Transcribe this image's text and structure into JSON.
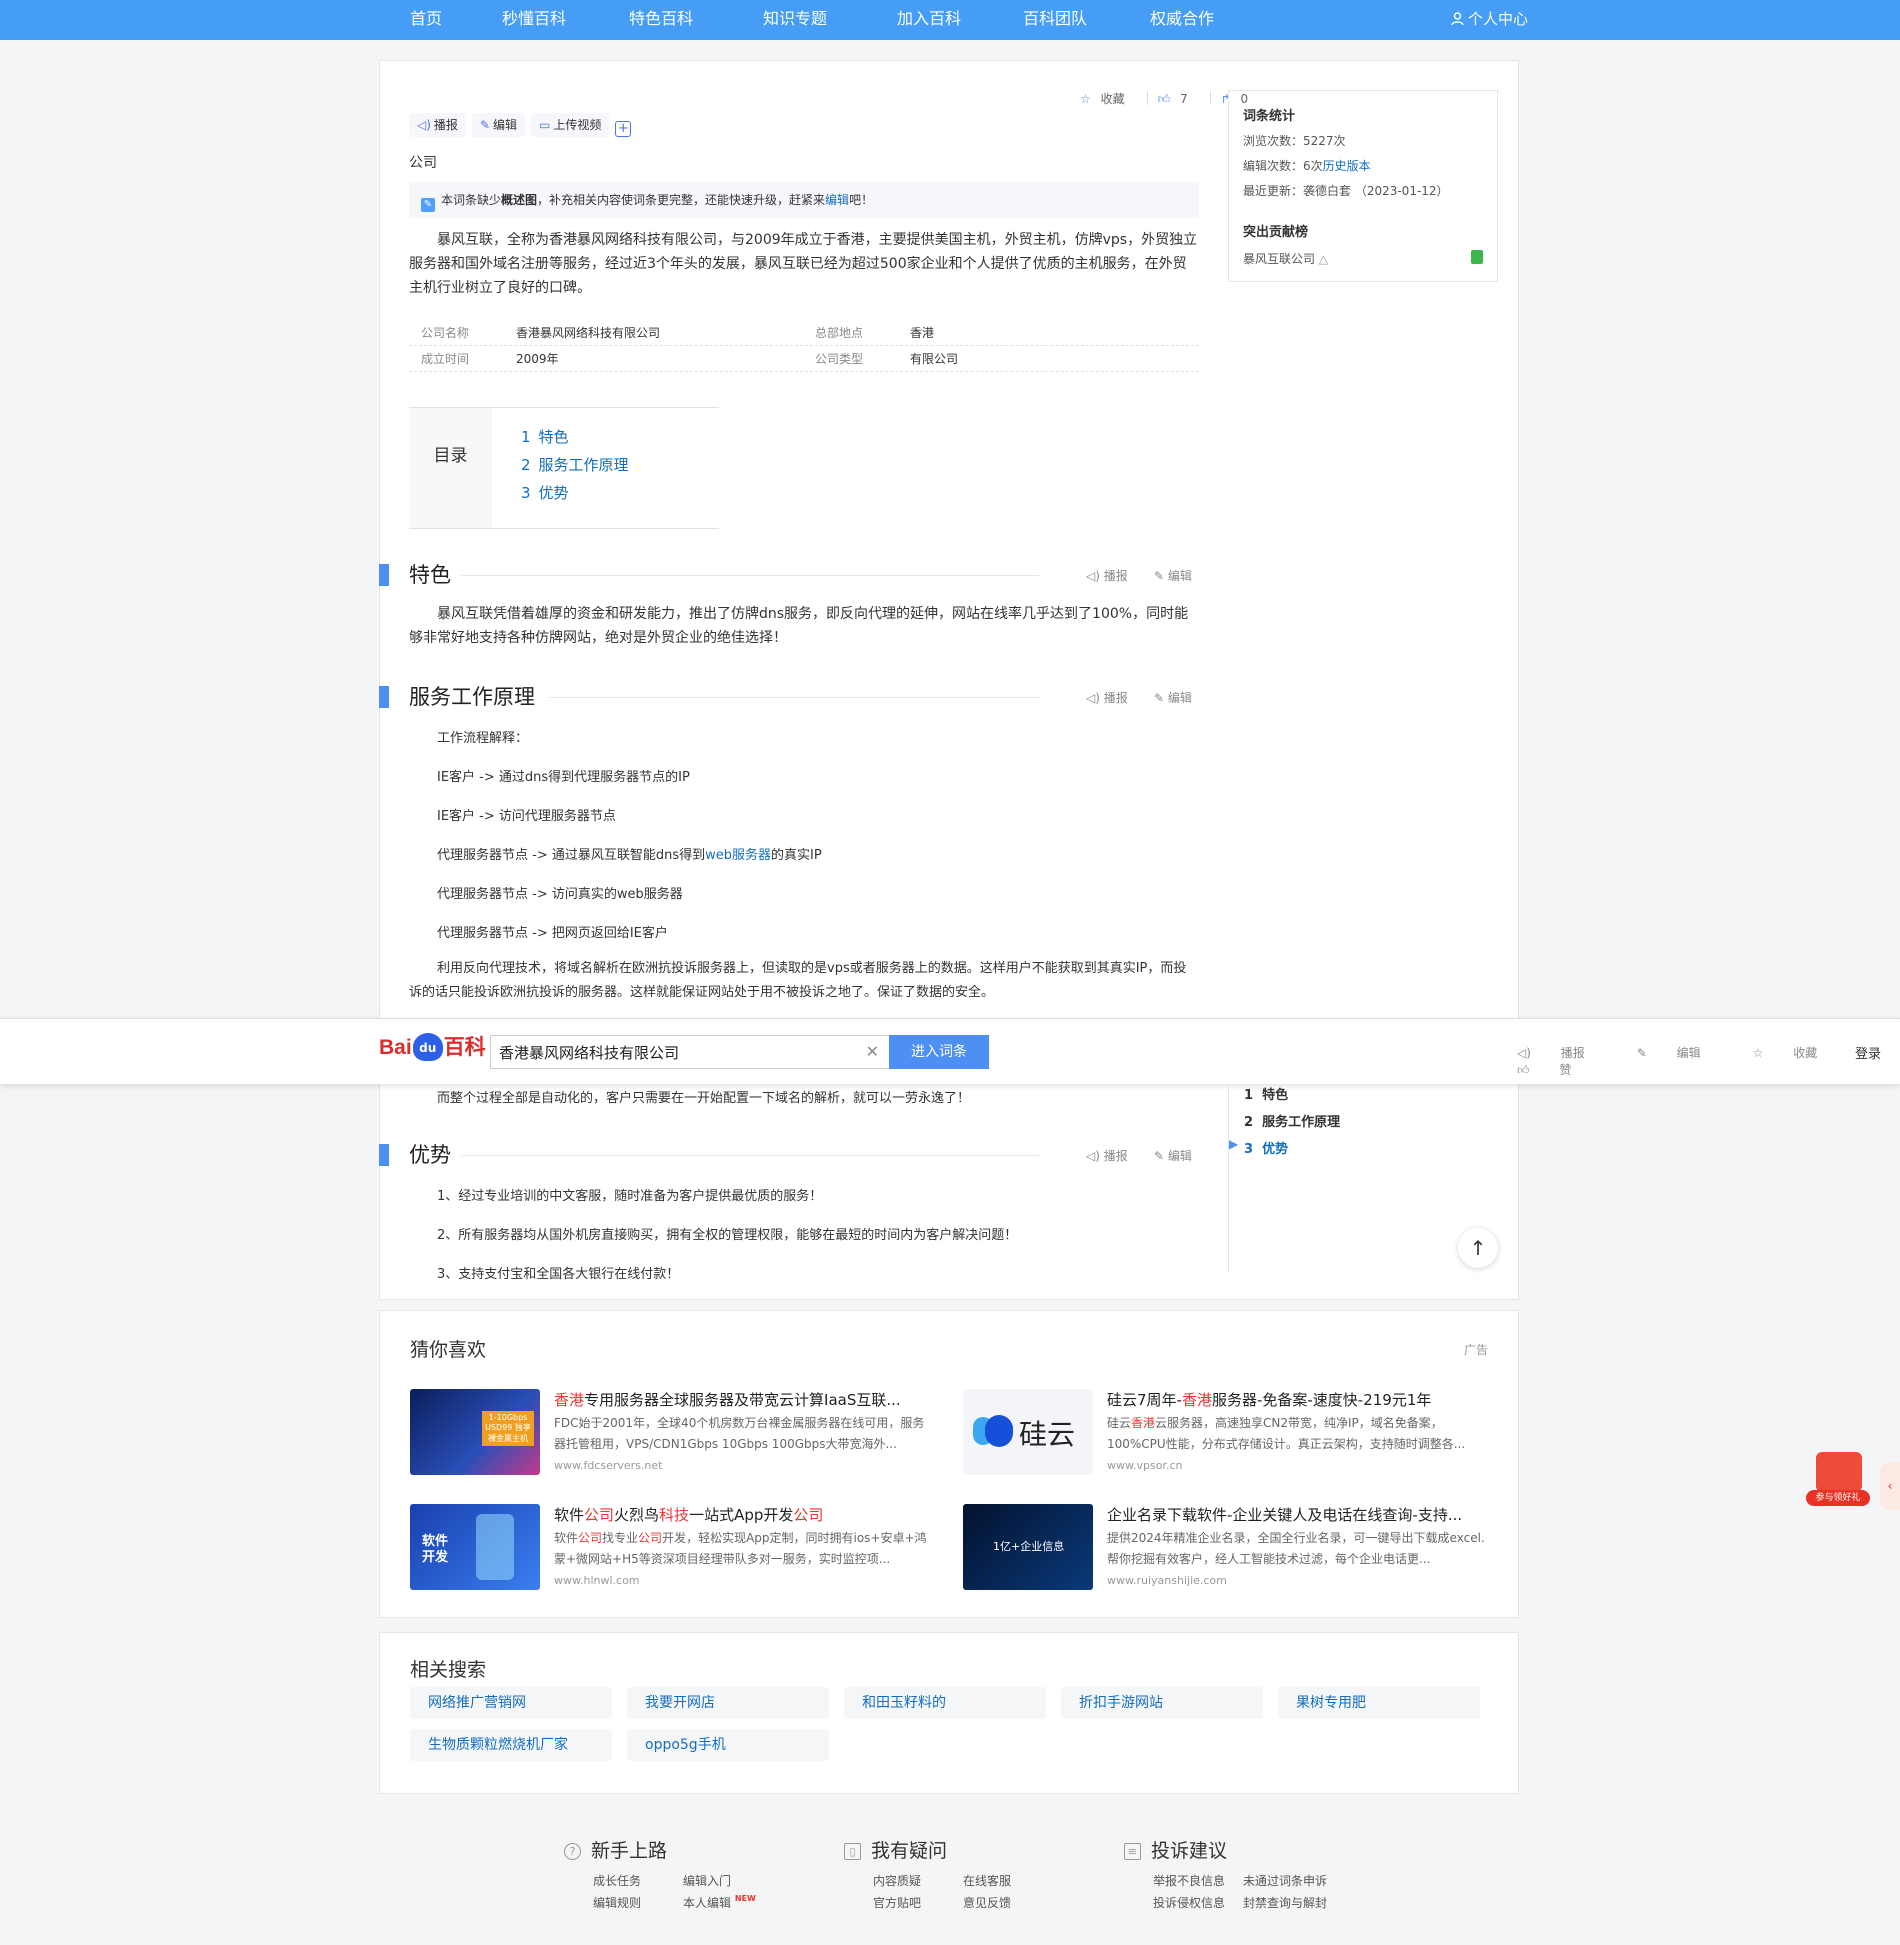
{
  "nav": {
    "items": [
      "首页",
      "秒懂百科",
      "特色百科",
      "知识专题",
      "加入百科",
      "百科团队",
      "权威合作"
    ],
    "user": "个人中心"
  },
  "top_actions": {
    "collect": "收藏",
    "like_count": "7",
    "share_count": "0"
  },
  "toolbar": {
    "broadcast": "播报",
    "edit": "编辑",
    "upload_video": "上传视频"
  },
  "category": "公司",
  "notice": {
    "pre": "本词条缺少",
    "bold": "概述图",
    "mid": "，补充相关内容使词条更完整，还能快速升级，赶紧来",
    "link": "编辑",
    "post": "吧！"
  },
  "intro": "暴风互联，全称为香港暴风网络科技有限公司，与2009年成立于香港，主要提供美国主机，外贸主机，仿牌vps，外贸独立服务器和国外域名注册等服务，经过近3个年头的发展，暴风互联已经为超过500家企业和个人提供了优质的主机服务，在外贸主机行业树立了良好的口碑。",
  "infobox": {
    "rows": [
      {
        "l1": "公司名称",
        "v1": "香港暴风网络科技有限公司",
        "l2": "总部地点",
        "v2": "香港"
      },
      {
        "l1": "成立时间",
        "v1": "2009年",
        "l2": "公司类型",
        "v2": "有限公司"
      }
    ]
  },
  "toc": {
    "label": "目录",
    "items": [
      {
        "n": "1",
        "t": "特色"
      },
      {
        "n": "2",
        "t": "服务工作原理"
      },
      {
        "n": "3",
        "t": "优势"
      }
    ]
  },
  "sections": {
    "features": {
      "title": "特色",
      "text": "暴风互联凭借着雄厚的资金和研发能力，推出了仿牌dns服务，即反向代理的延伸，网站在线率几乎达到了100%，同时能够非常好地支持各种仿牌网站，绝对是外贸企业的绝佳选择！"
    },
    "principle": {
      "title": "服务工作原理",
      "lines": [
        "工作流程解释：",
        "IE客户 -> 通过dns得到代理服务器节点的IP",
        "IE客户 -> 访问代理服务器节点",
        "代理服务器节点 -> 访问真实的web服务器",
        "代理服务器节点 -> 把网页返回给IE客户"
      ],
      "line4_pre": "代理服务器节点 -> 通过暴风互联智能dns得到",
      "line4_link": "web服务器",
      "line4_post": "的真实IP",
      "para": "利用反向代理技术，将域名解析在欧洲抗投诉服务器上，但读取的是vps或者服务器上的数据。这样用户不能获取到其真实IP，而投诉的话只能投诉欧洲抗投诉的服务器。这样就能保证网站处于用不被投诉之地了。保证了数据的安全。",
      "tail": "而整个过程全部是自动化的，客户只需要在一开始配置一下域名的解析，就可以一劳永逸了！"
    },
    "advantages": {
      "title": "优势",
      "lines": [
        "1、经过专业培训的中文客服，随时准备为客户提供最优质的服务！",
        "2、所有服务器均从国外机房直接购买，拥有全权的管理权限，能够在最短的时间内为客户解决问题！",
        "3、支持支付宝和全国各大银行在线付款！"
      ]
    }
  },
  "sidebar": {
    "stats_title": "词条统计",
    "views": "浏览次数：5227次",
    "edits_pre": "编辑次数：6次",
    "edits_link": "历史版本",
    "updated": "最近更新：袭德白套 （2023-01-12）",
    "contrib_title": "突出贡献榜",
    "contrib_name": "暴风互联公司"
  },
  "sticky": {
    "logo_bai": "Bai",
    "logo_du": "du",
    "logo_baike": "百科",
    "search_value": "香港暴风网络科技有限公司",
    "go": "进入词条",
    "actions": [
      "播报",
      "编辑",
      "收藏",
      "赞"
    ],
    "login": "登录"
  },
  "ads": {
    "title": "猜你喜欢",
    "label": "广告",
    "items": [
      {
        "title_red": "香港",
        "title": "专用服务器全球服务器及带宽云计算IaaS互联...",
        "desc": "FDC始于2001年，全球40个机房数万台裸金属服务器在线可用，服务器托管租用，VPS/CDN1Gbps 10Gbps 100Gbps大带宽海外...",
        "url": "www.fdcservers.net",
        "thumb_text": "1-10Gbps USD99 独享裸金属主机"
      },
      {
        "title_pre": "硅云7周年-",
        "title_red": "香港",
        "title": "服务器-免备案-速度快-219元1年",
        "desc_pre": "硅云",
        "desc_red": "香港",
        "desc": "云服务器，高速独享CN2带宽，纯净IP，域名免备案，100%CPU性能，分布式存储设计。真正云架构，支持随时调整各...",
        "url": "www.vpsor.cn",
        "thumb_text": "硅云"
      },
      {
        "title_a": "软件",
        "title_red1": "公司",
        "title_b": "火烈鸟",
        "title_red2": "科技",
        "title_c": "一站式App开发",
        "title_red3": "公司",
        "desc_a": "软件",
        "desc_red1": "公司",
        "desc_b": "找专业",
        "desc_red2": "公司",
        "desc_c": "开发，轻松实现App定制，同时拥有ios+安卓+鸿蒙+微网站+H5等资深项目经理带队多对一服务，实时监控项...",
        "url": "www.hlnwl.com",
        "thumb_text": "软件 开发"
      },
      {
        "title": "企业名录下载软件-企业关键人及电话在线查询-支持...",
        "desc": "提供2024年精准企业名录，全国全行业名录，可一键导出下载成excel.帮你挖掘有效客户，经人工智能技术过滤，每个企业电话更...",
        "url": "www.ruiyanshijie.com",
        "thumb_text": "1亿+企业信息"
      }
    ]
  },
  "related": {
    "title": "相关搜索",
    "tags": [
      "网络推广营销网",
      "我要开网店",
      "和田玉籽料的",
      "折扣手游网站",
      "果树专用肥",
      "生物质颗粒燃烧机厂家",
      "oppo5g手机"
    ]
  },
  "footer": {
    "cols": [
      {
        "title": "新手上路",
        "links": [
          "成长任务",
          "编辑入门",
          "编辑规则",
          "本人编辑"
        ],
        "new": "NEW"
      },
      {
        "title": "我有疑问",
        "links": [
          "内容质疑",
          "在线客服",
          "官方贴吧",
          "意见反馈"
        ]
      },
      {
        "title": "投诉建议",
        "links": [
          "举报不良信息",
          "未通过词条申诉",
          "投诉侵权信息",
          "封禁查询与解封"
        ]
      }
    ]
  },
  "gift": {
    "label": "参与领好礼"
  },
  "colors": {
    "nav": "#459df5",
    "accent": "#4e8ff2",
    "link": "#136ec2",
    "ad_red": "#e33333"
  }
}
